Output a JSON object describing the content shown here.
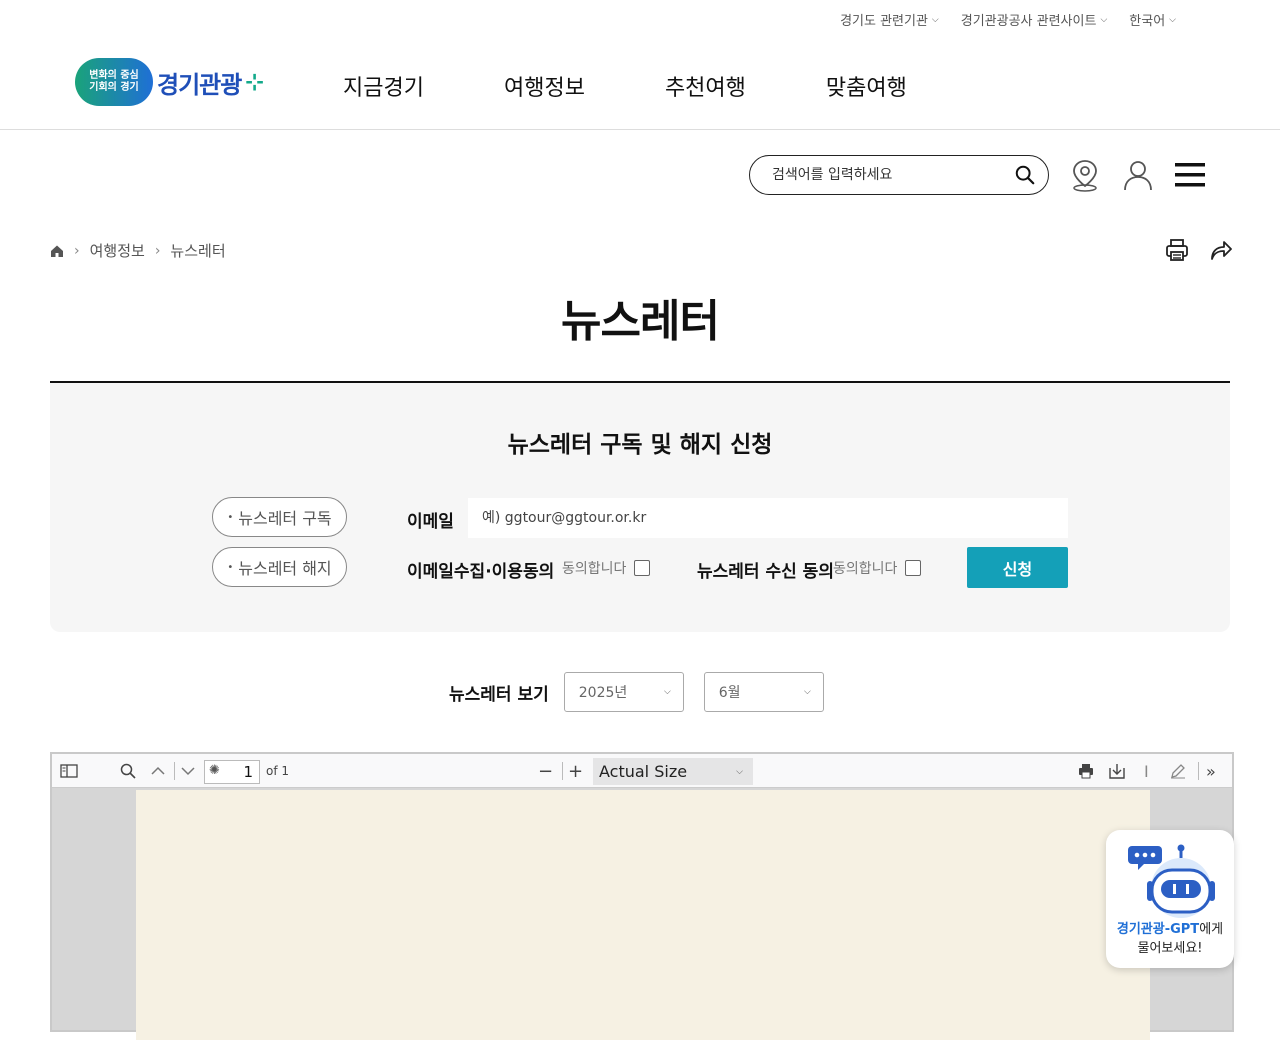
{
  "top_links": [
    {
      "label": "경기도 관련기관"
    },
    {
      "label": "경기관광공사 관련사이트"
    },
    {
      "label": "한국어"
    }
  ],
  "logo": {
    "badge_line1": "변화의 중심",
    "badge_line2": "기회의 경기",
    "text": "경기관광"
  },
  "gnb": [
    {
      "label": "지금경기"
    },
    {
      "label": "여행정보"
    },
    {
      "label": "추천여행"
    },
    {
      "label": "맞춤여행"
    }
  ],
  "search": {
    "placeholder": "검색어를 입력하세요"
  },
  "breadcrumb": {
    "items": [
      "여행정보",
      "뉴스레터"
    ]
  },
  "page_title": "뉴스레터",
  "subscribe": {
    "title": "뉴스레터 구독 및 해지 신청",
    "subscribe_btn": "뉴스레터 구독",
    "unsubscribe_btn": "뉴스레터 해지",
    "email_label": "이메일",
    "email_placeholder": "예) ggtour@ggtour.or.kr",
    "consent_collect_label": "이메일수집·이용동의",
    "consent_receive_label": "뉴스레터 수신 동의",
    "agree_text": "동의합니다",
    "submit": "신청"
  },
  "viewer": {
    "label": "뉴스레터 보기",
    "year": "2025년",
    "month": "6월"
  },
  "pdf": {
    "page_number": "1",
    "page_count": "of 1",
    "zoom": "Actual Size"
  },
  "gpt": {
    "brand": "경기관광-GPT",
    "suffix": "에게",
    "line2": "물어보세요!"
  }
}
